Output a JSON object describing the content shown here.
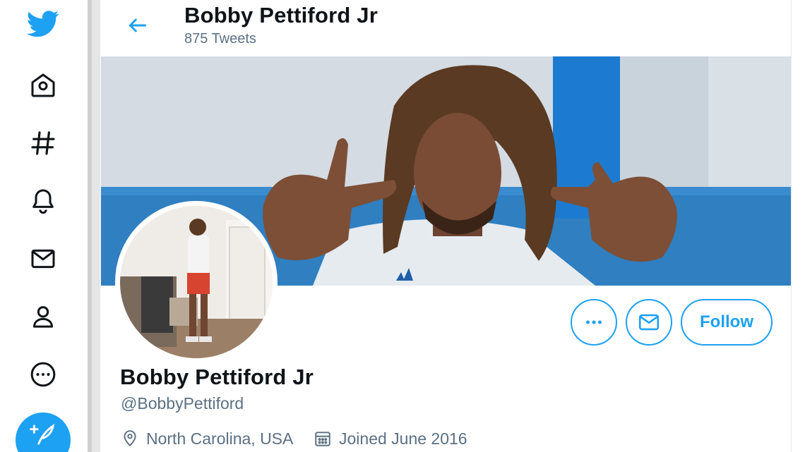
{
  "nav": {
    "items": [
      {
        "name": "twitter-logo-icon"
      },
      {
        "name": "home-icon"
      },
      {
        "name": "explore-hashtag-icon"
      },
      {
        "name": "notifications-bell-icon"
      },
      {
        "name": "messages-mail-icon"
      },
      {
        "name": "profile-person-icon"
      },
      {
        "name": "more-options-icon"
      },
      {
        "name": "compose-tweet-icon"
      }
    ]
  },
  "header": {
    "title": "Bobby Pettiford Jr",
    "tweet_count": "875 Tweets"
  },
  "profile": {
    "display_name": "Bobby Pettiford Jr",
    "handle": "@BobbyPettiford",
    "location": "North Carolina, USA",
    "joined": "Joined June 2016"
  },
  "actions": {
    "follow_label": "Follow"
  },
  "colors": {
    "accent": "#1da1f2",
    "text_primary": "#0f1419",
    "text_secondary": "#5b7083"
  }
}
